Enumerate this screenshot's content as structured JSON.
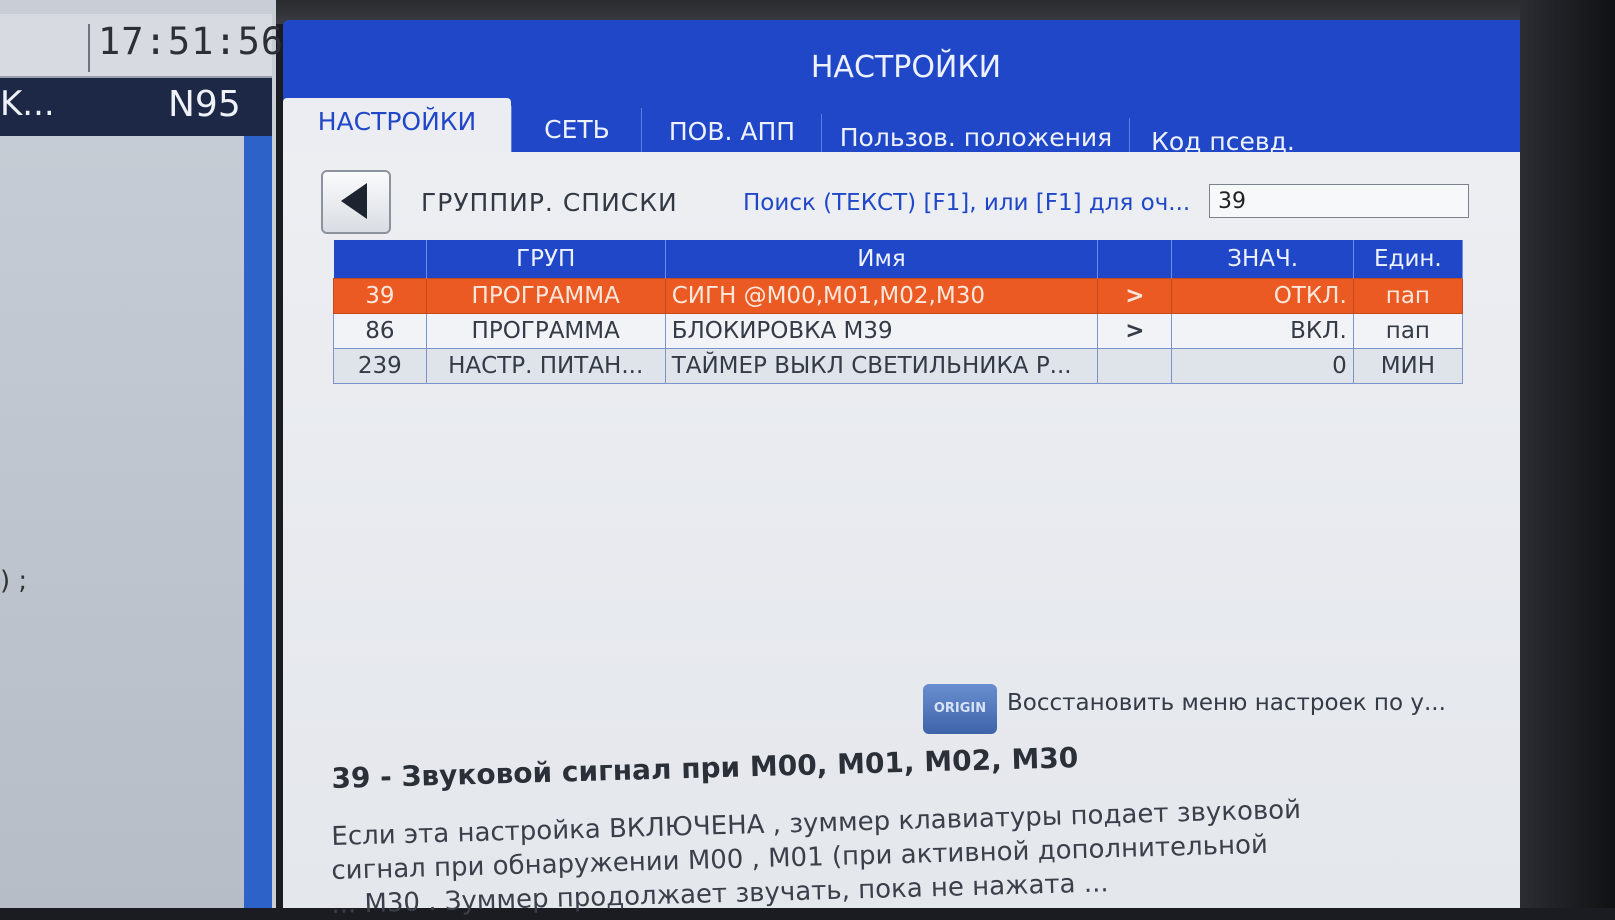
{
  "left_panel": {
    "clock": "17:51:56",
    "header_left": "K...",
    "header_right": "N95",
    "side_mark": ") ;"
  },
  "window": {
    "title": "НАСТРОЙКИ",
    "tabs": [
      {
        "label": "НАСТРОЙКИ",
        "active": true
      },
      {
        "label": "СЕТЬ",
        "active": false
      },
      {
        "label": "ПОВ. АПП",
        "active": false
      },
      {
        "label": "Пользов. положения",
        "active": false
      },
      {
        "label": "Код псевд.",
        "active": false
      }
    ]
  },
  "toolbar": {
    "group_lists_label": "ГРУППИР. СПИСКИ",
    "search_label": "Поиск (ТЕКСТ) [F1], или [F1] для оч...",
    "search_value": "39"
  },
  "table": {
    "headers": [
      "",
      "ГРУП",
      "Имя",
      "",
      "ЗНАЧ.",
      "Един."
    ],
    "rows": [
      {
        "num": "39",
        "group": "ПРОГРАММА",
        "name": "СИГН @M00,M01,M02,M30",
        "arrow": ">",
        "value": "ОТКЛ.",
        "unit": "пап",
        "selected": true
      },
      {
        "num": "86",
        "group": "ПРОГРАММА",
        "name": "БЛОКИРОВКА M39",
        "arrow": ">",
        "value": "ВКЛ.",
        "unit": "пап",
        "selected": false
      },
      {
        "num": "239",
        "group": "НАСТР. ПИТАН...",
        "name": "ТАЙМЕР ВЫКЛ СВЕТИЛЬНИКА Р...",
        "arrow": "",
        "value": "0",
        "unit": "МИН",
        "selected": false
      }
    ]
  },
  "origin": {
    "button_label": "ORIGIN",
    "label": "Восстановить меню настроек по у..."
  },
  "description": {
    "title": "39 - Звуковой сигнал при M00, M01, M02, M30",
    "lines": [
      "Если эта настройка ВКЛЮЧЕНА , зуммер клавиатуры подает звуковой",
      "сигнал при обнаружении M00 , M01 (при активной дополнительной",
      "... M30 . Зуммер продолжает звучать, пока не нажата ..."
    ]
  },
  "colors": {
    "window_blue": "#2047c8",
    "selected_row": "#ec5a23",
    "left_stripe": "#2d63c9"
  }
}
